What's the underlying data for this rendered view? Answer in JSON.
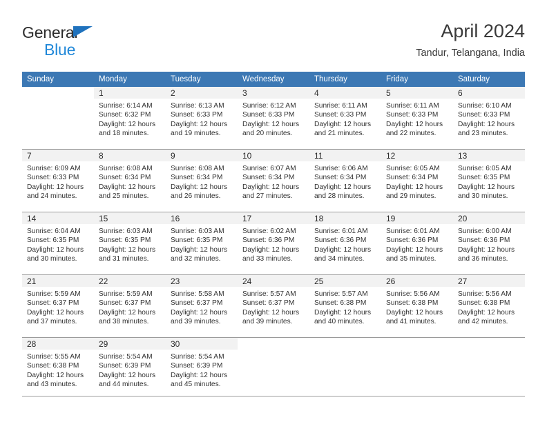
{
  "brand": {
    "name_part1": "General",
    "name_part2": "Blue",
    "triangle_icon": "triangle-icon",
    "accent_blue": "#1f72bd",
    "light_blue": "#1f87d8"
  },
  "header": {
    "title": "April 2024",
    "subtitle": "Tandur, Telangana, India"
  },
  "colors": {
    "header_row_bg": "#3c78b4",
    "header_row_text": "#ffffff",
    "daynum_band_bg": "#f2f2f2",
    "grid_line": "#9a9a9a",
    "body_text": "#313131"
  },
  "weekday_headers": [
    "Sunday",
    "Monday",
    "Tuesday",
    "Wednesday",
    "Thursday",
    "Friday",
    "Saturday"
  ],
  "weeks": [
    [
      {
        "day": "",
        "blank": true,
        "sunrise": "",
        "sunset": "",
        "daylight_line1": "",
        "daylight_line2": ""
      },
      {
        "day": "1",
        "blank": false,
        "sunrise": "Sunrise: 6:14 AM",
        "sunset": "Sunset: 6:32 PM",
        "daylight_line1": "Daylight: 12 hours",
        "daylight_line2": "and 18 minutes."
      },
      {
        "day": "2",
        "blank": false,
        "sunrise": "Sunrise: 6:13 AM",
        "sunset": "Sunset: 6:33 PM",
        "daylight_line1": "Daylight: 12 hours",
        "daylight_line2": "and 19 minutes."
      },
      {
        "day": "3",
        "blank": false,
        "sunrise": "Sunrise: 6:12 AM",
        "sunset": "Sunset: 6:33 PM",
        "daylight_line1": "Daylight: 12 hours",
        "daylight_line2": "and 20 minutes."
      },
      {
        "day": "4",
        "blank": false,
        "sunrise": "Sunrise: 6:11 AM",
        "sunset": "Sunset: 6:33 PM",
        "daylight_line1": "Daylight: 12 hours",
        "daylight_line2": "and 21 minutes."
      },
      {
        "day": "5",
        "blank": false,
        "sunrise": "Sunrise: 6:11 AM",
        "sunset": "Sunset: 6:33 PM",
        "daylight_line1": "Daylight: 12 hours",
        "daylight_line2": "and 22 minutes."
      },
      {
        "day": "6",
        "blank": false,
        "sunrise": "Sunrise: 6:10 AM",
        "sunset": "Sunset: 6:33 PM",
        "daylight_line1": "Daylight: 12 hours",
        "daylight_line2": "and 23 minutes."
      }
    ],
    [
      {
        "day": "7",
        "blank": false,
        "sunrise": "Sunrise: 6:09 AM",
        "sunset": "Sunset: 6:33 PM",
        "daylight_line1": "Daylight: 12 hours",
        "daylight_line2": "and 24 minutes."
      },
      {
        "day": "8",
        "blank": false,
        "sunrise": "Sunrise: 6:08 AM",
        "sunset": "Sunset: 6:34 PM",
        "daylight_line1": "Daylight: 12 hours",
        "daylight_line2": "and 25 minutes."
      },
      {
        "day": "9",
        "blank": false,
        "sunrise": "Sunrise: 6:08 AM",
        "sunset": "Sunset: 6:34 PM",
        "daylight_line1": "Daylight: 12 hours",
        "daylight_line2": "and 26 minutes."
      },
      {
        "day": "10",
        "blank": false,
        "sunrise": "Sunrise: 6:07 AM",
        "sunset": "Sunset: 6:34 PM",
        "daylight_line1": "Daylight: 12 hours",
        "daylight_line2": "and 27 minutes."
      },
      {
        "day": "11",
        "blank": false,
        "sunrise": "Sunrise: 6:06 AM",
        "sunset": "Sunset: 6:34 PM",
        "daylight_line1": "Daylight: 12 hours",
        "daylight_line2": "and 28 minutes."
      },
      {
        "day": "12",
        "blank": false,
        "sunrise": "Sunrise: 6:05 AM",
        "sunset": "Sunset: 6:34 PM",
        "daylight_line1": "Daylight: 12 hours",
        "daylight_line2": "and 29 minutes."
      },
      {
        "day": "13",
        "blank": false,
        "sunrise": "Sunrise: 6:05 AM",
        "sunset": "Sunset: 6:35 PM",
        "daylight_line1": "Daylight: 12 hours",
        "daylight_line2": "and 30 minutes."
      }
    ],
    [
      {
        "day": "14",
        "blank": false,
        "sunrise": "Sunrise: 6:04 AM",
        "sunset": "Sunset: 6:35 PM",
        "daylight_line1": "Daylight: 12 hours",
        "daylight_line2": "and 30 minutes."
      },
      {
        "day": "15",
        "blank": false,
        "sunrise": "Sunrise: 6:03 AM",
        "sunset": "Sunset: 6:35 PM",
        "daylight_line1": "Daylight: 12 hours",
        "daylight_line2": "and 31 minutes."
      },
      {
        "day": "16",
        "blank": false,
        "sunrise": "Sunrise: 6:03 AM",
        "sunset": "Sunset: 6:35 PM",
        "daylight_line1": "Daylight: 12 hours",
        "daylight_line2": "and 32 minutes."
      },
      {
        "day": "17",
        "blank": false,
        "sunrise": "Sunrise: 6:02 AM",
        "sunset": "Sunset: 6:36 PM",
        "daylight_line1": "Daylight: 12 hours",
        "daylight_line2": "and 33 minutes."
      },
      {
        "day": "18",
        "blank": false,
        "sunrise": "Sunrise: 6:01 AM",
        "sunset": "Sunset: 6:36 PM",
        "daylight_line1": "Daylight: 12 hours",
        "daylight_line2": "and 34 minutes."
      },
      {
        "day": "19",
        "blank": false,
        "sunrise": "Sunrise: 6:01 AM",
        "sunset": "Sunset: 6:36 PM",
        "daylight_line1": "Daylight: 12 hours",
        "daylight_line2": "and 35 minutes."
      },
      {
        "day": "20",
        "blank": false,
        "sunrise": "Sunrise: 6:00 AM",
        "sunset": "Sunset: 6:36 PM",
        "daylight_line1": "Daylight: 12 hours",
        "daylight_line2": "and 36 minutes."
      }
    ],
    [
      {
        "day": "21",
        "blank": false,
        "sunrise": "Sunrise: 5:59 AM",
        "sunset": "Sunset: 6:37 PM",
        "daylight_line1": "Daylight: 12 hours",
        "daylight_line2": "and 37 minutes."
      },
      {
        "day": "22",
        "blank": false,
        "sunrise": "Sunrise: 5:59 AM",
        "sunset": "Sunset: 6:37 PM",
        "daylight_line1": "Daylight: 12 hours",
        "daylight_line2": "and 38 minutes."
      },
      {
        "day": "23",
        "blank": false,
        "sunrise": "Sunrise: 5:58 AM",
        "sunset": "Sunset: 6:37 PM",
        "daylight_line1": "Daylight: 12 hours",
        "daylight_line2": "and 39 minutes."
      },
      {
        "day": "24",
        "blank": false,
        "sunrise": "Sunrise: 5:57 AM",
        "sunset": "Sunset: 6:37 PM",
        "daylight_line1": "Daylight: 12 hours",
        "daylight_line2": "and 39 minutes."
      },
      {
        "day": "25",
        "blank": false,
        "sunrise": "Sunrise: 5:57 AM",
        "sunset": "Sunset: 6:38 PM",
        "daylight_line1": "Daylight: 12 hours",
        "daylight_line2": "and 40 minutes."
      },
      {
        "day": "26",
        "blank": false,
        "sunrise": "Sunrise: 5:56 AM",
        "sunset": "Sunset: 6:38 PM",
        "daylight_line1": "Daylight: 12 hours",
        "daylight_line2": "and 41 minutes."
      },
      {
        "day": "27",
        "blank": false,
        "sunrise": "Sunrise: 5:56 AM",
        "sunset": "Sunset: 6:38 PM",
        "daylight_line1": "Daylight: 12 hours",
        "daylight_line2": "and 42 minutes."
      }
    ],
    [
      {
        "day": "28",
        "blank": false,
        "sunrise": "Sunrise: 5:55 AM",
        "sunset": "Sunset: 6:38 PM",
        "daylight_line1": "Daylight: 12 hours",
        "daylight_line2": "and 43 minutes."
      },
      {
        "day": "29",
        "blank": false,
        "sunrise": "Sunrise: 5:54 AM",
        "sunset": "Sunset: 6:39 PM",
        "daylight_line1": "Daylight: 12 hours",
        "daylight_line2": "and 44 minutes."
      },
      {
        "day": "30",
        "blank": false,
        "sunrise": "Sunrise: 5:54 AM",
        "sunset": "Sunset: 6:39 PM",
        "daylight_line1": "Daylight: 12 hours",
        "daylight_line2": "and 45 minutes."
      },
      {
        "day": "",
        "blank": true,
        "sunrise": "",
        "sunset": "",
        "daylight_line1": "",
        "daylight_line2": ""
      },
      {
        "day": "",
        "blank": true,
        "sunrise": "",
        "sunset": "",
        "daylight_line1": "",
        "daylight_line2": ""
      },
      {
        "day": "",
        "blank": true,
        "sunrise": "",
        "sunset": "",
        "daylight_line1": "",
        "daylight_line2": ""
      },
      {
        "day": "",
        "blank": true,
        "sunrise": "",
        "sunset": "",
        "daylight_line1": "",
        "daylight_line2": ""
      }
    ]
  ]
}
